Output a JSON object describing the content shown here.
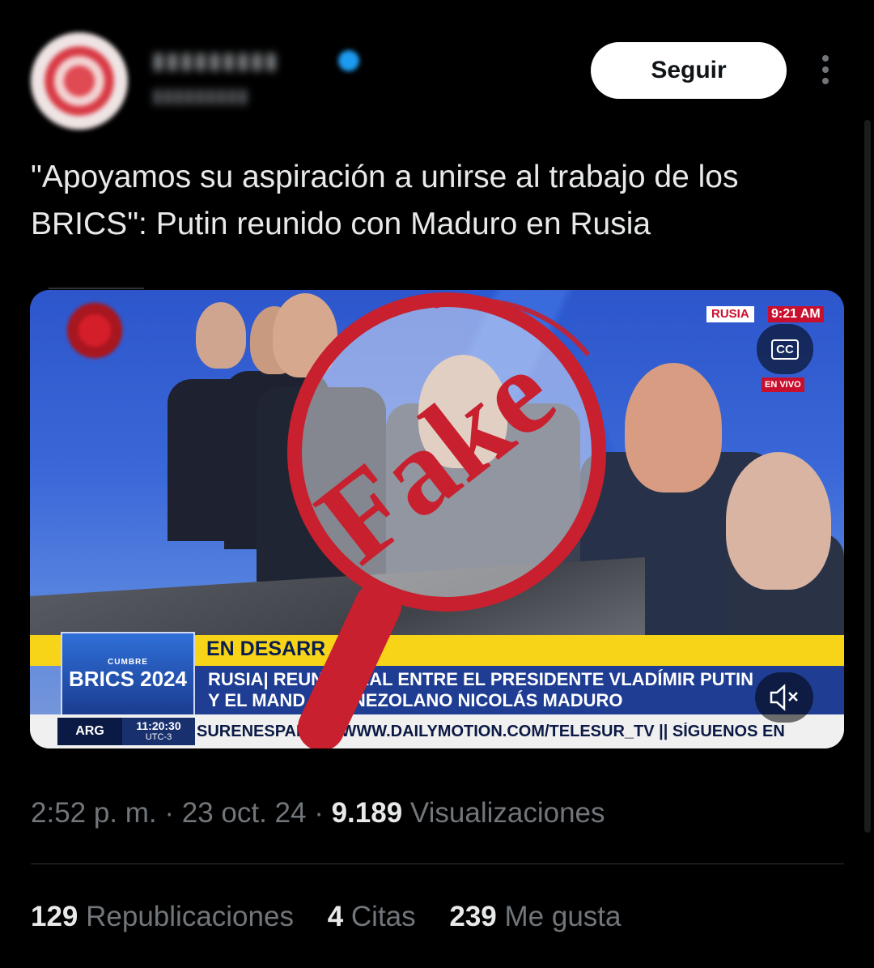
{
  "author": {
    "follow_label": "Seguir"
  },
  "tweet": {
    "text": "\"Apoyamos su aspiración a unirse al trabajo de los BRICS\": Putin reunido con Maduro en Rusia"
  },
  "video": {
    "top_tag_country": "RUSIA",
    "top_tag_time": "9:21 AM",
    "live_tag": "EN VIVO",
    "cc_label": "CC",
    "stamp_text": "Fake",
    "lower_third_label": "EN DESARR",
    "lower_third_line1": "RUSIA| REUNI        TERAL ENTRE EL PRESIDENTE VLADÍMIR PUTIN",
    "lower_third_line2": "Y EL MAND        O VENEZOLANO NICOLÁS MADURO",
    "brics_small": "CUMBRE",
    "brics_big": "BRICS 2024",
    "ticker_country": "ARG",
    "ticker_time": "11:20:30",
    "ticker_tz": "UTC-3",
    "ticker_text": "SURENESPANO       N WWW.DAILYMOTION.COM/TELESUR_TV || SÍGUENOS EN"
  },
  "meta": {
    "time": "2:52 p. m.",
    "sep1": " · ",
    "date": "23 oct. 24",
    "sep2": " · ",
    "views_count": "9.189",
    "views_label": " Visualizaciones"
  },
  "stats": [
    {
      "count": "129",
      "label": " Republicaciones"
    },
    {
      "count": "4",
      "label": " Citas"
    },
    {
      "count": "239",
      "label": " Me gusta"
    }
  ],
  "colors": {
    "stamp_red": "#c8202e",
    "follow_bg": "#ffffff",
    "muted_text": "#71767b"
  }
}
